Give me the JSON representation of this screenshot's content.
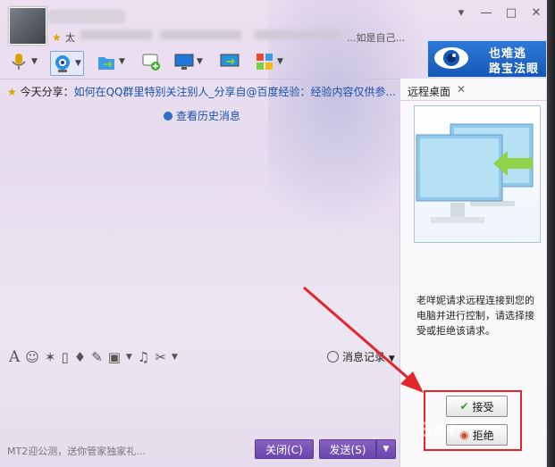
{
  "title_bar": {
    "signature_fragment_left": "太",
    "signature_fragment_right": "...如是自己...",
    "min_label": "—",
    "max_label": "□",
    "close_label": "✕",
    "menu_label": "▾"
  },
  "ad_banner": {
    "line1": "也难逃",
    "line2": "路宝法眼",
    "color": "#1f66c8"
  },
  "toolbar": {
    "icons": [
      "microphone-icon",
      "video-call-icon",
      "file-transfer-icon",
      "create-group-icon",
      "screen-share-icon",
      "remote-desktop-icon",
      "apps-icon"
    ]
  },
  "share": {
    "label": "今天分享：",
    "link": "如何在QQ群里特别关注别人_分享自@百度经验：经验内容仅供参..."
  },
  "history": {
    "label": "查看历史消息"
  },
  "bottom_tools": {
    "message_record": "消息记录"
  },
  "footer": {
    "ad_text": "MT2迎公测，送你管家独家礼...",
    "close_button": "关闭(C)",
    "send_button": "发送(S)"
  },
  "remote_panel": {
    "tab_label": "远程桌面",
    "message": "老咩妮请求远程连接到您的电脑并进行控制，请选择接受或拒绝该请求。",
    "accept_button": "接受",
    "reject_button": "拒绝"
  },
  "watermark": {
    "text": "Bai"
  },
  "colors": {
    "accent_purple": "#6b45ab",
    "link_blue": "#1a52a8",
    "highlight_red": "#e2262a"
  }
}
